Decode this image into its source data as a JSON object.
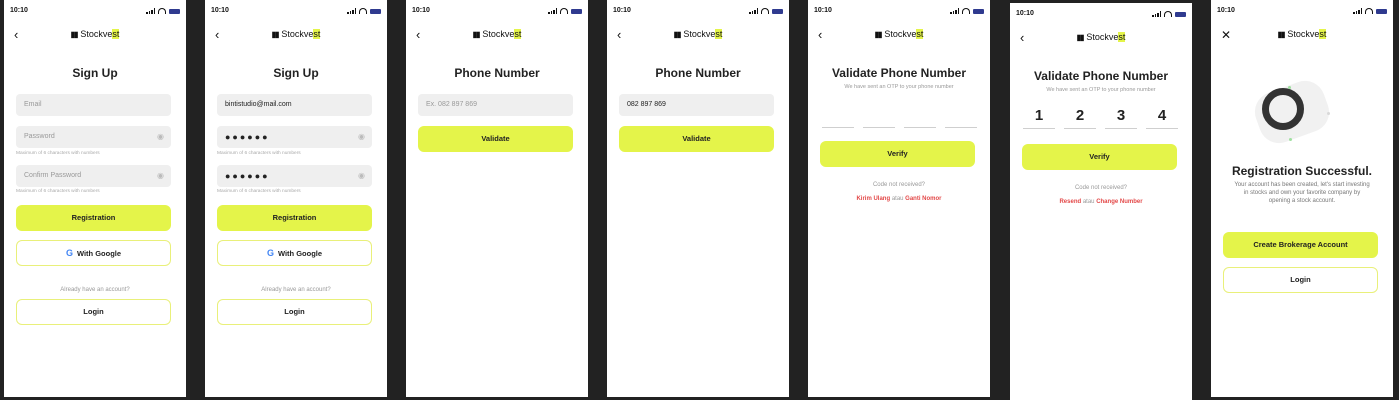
{
  "status": {
    "time": "10:10"
  },
  "brand": {
    "prefix": "Stockve",
    "highlight": "st"
  },
  "colors": {
    "accent": "#e4f44a",
    "link": "#e34848",
    "background": "#222222"
  },
  "screens": {
    "s1": {
      "title": "Sign Up",
      "email_placeholder": "Email",
      "password_placeholder": "Password",
      "password_hint": "Maximum of 6 characters with numbers",
      "confirm_placeholder": "Confirm Password",
      "confirm_hint": "Maximum of 6 characters with numbers",
      "registration": "Registration",
      "google": "With Google",
      "have_account": "Already have an account?",
      "login": "Login"
    },
    "s2": {
      "title": "Sign Up",
      "email_value": "bintistudio@mail.com",
      "password_value": "●●●●●●",
      "password_hint": "Maximum of 6 characters with numbers",
      "confirm_value": "●●●●●●",
      "confirm_hint": "Maximum of 6 characters with numbers",
      "registration": "Registration",
      "google": "With Google",
      "have_account": "Already have an account?",
      "login": "Login"
    },
    "s3": {
      "title": "Phone Number",
      "phone_placeholder": "Ex. 082 897 869",
      "validate": "Validate"
    },
    "s4": {
      "title": "Phone Number",
      "phone_value": "082 897 869",
      "validate": "Validate"
    },
    "s5": {
      "title": "Validate Phone Number",
      "subtitle": "We have sent an OTP to your phone number",
      "verify": "Verify",
      "not_received": "Code not received?",
      "resend": "Kirim Ulang",
      "or": "atau",
      "change": "Ganti Nomor"
    },
    "s6": {
      "time": "10:10",
      "title": "Validate Phone Number",
      "subtitle": "We have sent an OTP to your phone number",
      "otp": [
        "1",
        "2",
        "3",
        "4"
      ],
      "verify": "Verify",
      "not_received": "Code not received?",
      "resend": "Resend",
      "or": "atau",
      "change": "Change Number"
    },
    "s7": {
      "title": "Registration Successful.",
      "description": "Your account has been created, let's start investing in stocks and own your favorite company by opening a stock account.",
      "create": "Create Brokerage Account",
      "login": "Login"
    }
  }
}
